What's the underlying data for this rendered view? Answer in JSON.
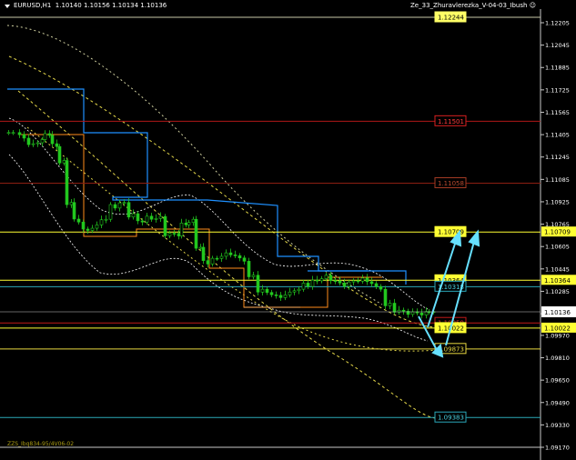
{
  "header": {
    "symbol_label": "EURUSD,H1",
    "ohlc": "1.10140 1.10156 1.10134 1.10136",
    "indicator": "Ze_33_Zhuravlerezka_V-04-03_Ibush"
  },
  "footer": {
    "label": "ZZS_Ibq834-95/4V06-02"
  },
  "price_axis": {
    "ticks": [
      "1.12205",
      "1.12045",
      "1.11885",
      "1.11725",
      "1.11565",
      "1.11405",
      "1.11245",
      "1.11085",
      "1.10925",
      "1.10765",
      "1.10605",
      "1.10445",
      "1.10285",
      "1.10125",
      "1.09970",
      "1.09810",
      "1.09650",
      "1.09490",
      "1.09330",
      "1.09170"
    ],
    "current_price": "1.10136"
  },
  "levels": [
    {
      "label": "1.12244",
      "line_color": "#c9c9a8",
      "box_color": "#ffff66",
      "text_color": "#000000",
      "fill": "#ffff66"
    },
    {
      "label": "1.11501",
      "line_color": "#b01818",
      "box_color": "#d92020",
      "text_color": "#ff3b3b",
      "fill": "#000000"
    },
    {
      "label": "1.11058",
      "line_color": "#8c1f12",
      "box_color": "#a33b24",
      "text_color": "#b94a30",
      "fill": "#000000"
    },
    {
      "label": "1.10709",
      "line_color": "#ffff33",
      "box_color": "#ffff33",
      "text_color": "#000000",
      "fill": "#ffff33"
    },
    {
      "label": "1.10364",
      "line_color": "#ffff33",
      "box_color": "#ffff33",
      "text_color": "#000000",
      "fill": "#ffff33"
    },
    {
      "label": "1.10318",
      "line_color": "#2aa7b8",
      "box_color": "#2aa7b8",
      "text_color": "#49d0e0",
      "fill": "#000000"
    },
    {
      "label": "1.10059",
      "line_color": "#c01818",
      "box_color": "#c01818",
      "text_color": "#e03030",
      "fill": "#000000"
    },
    {
      "label": "1.10022",
      "line_color": "#ffff33",
      "box_color": "#ffff33",
      "text_color": "#000000",
      "fill": "#ffff33"
    },
    {
      "label": "1.09873",
      "line_color": "#e8d840",
      "box_color": "#e8d840",
      "text_color": "#e8d840",
      "fill": "#000000"
    },
    {
      "label": "1.09383",
      "line_color": "#2aa7b8",
      "box_color": "#2aa7b8",
      "text_color": "#49d0e0",
      "fill": "#000000"
    }
  ],
  "colors": {
    "background": "#000000",
    "up_candle": "#22c81e",
    "down_candle": "#22c81e",
    "forecast_arrows": "#66e0ff",
    "zigzag": "#1e90ff",
    "orange_lines": "#ff8c1a",
    "yellow_dashed": "#e6d94a",
    "white_dotted": "#ffffff"
  }
}
